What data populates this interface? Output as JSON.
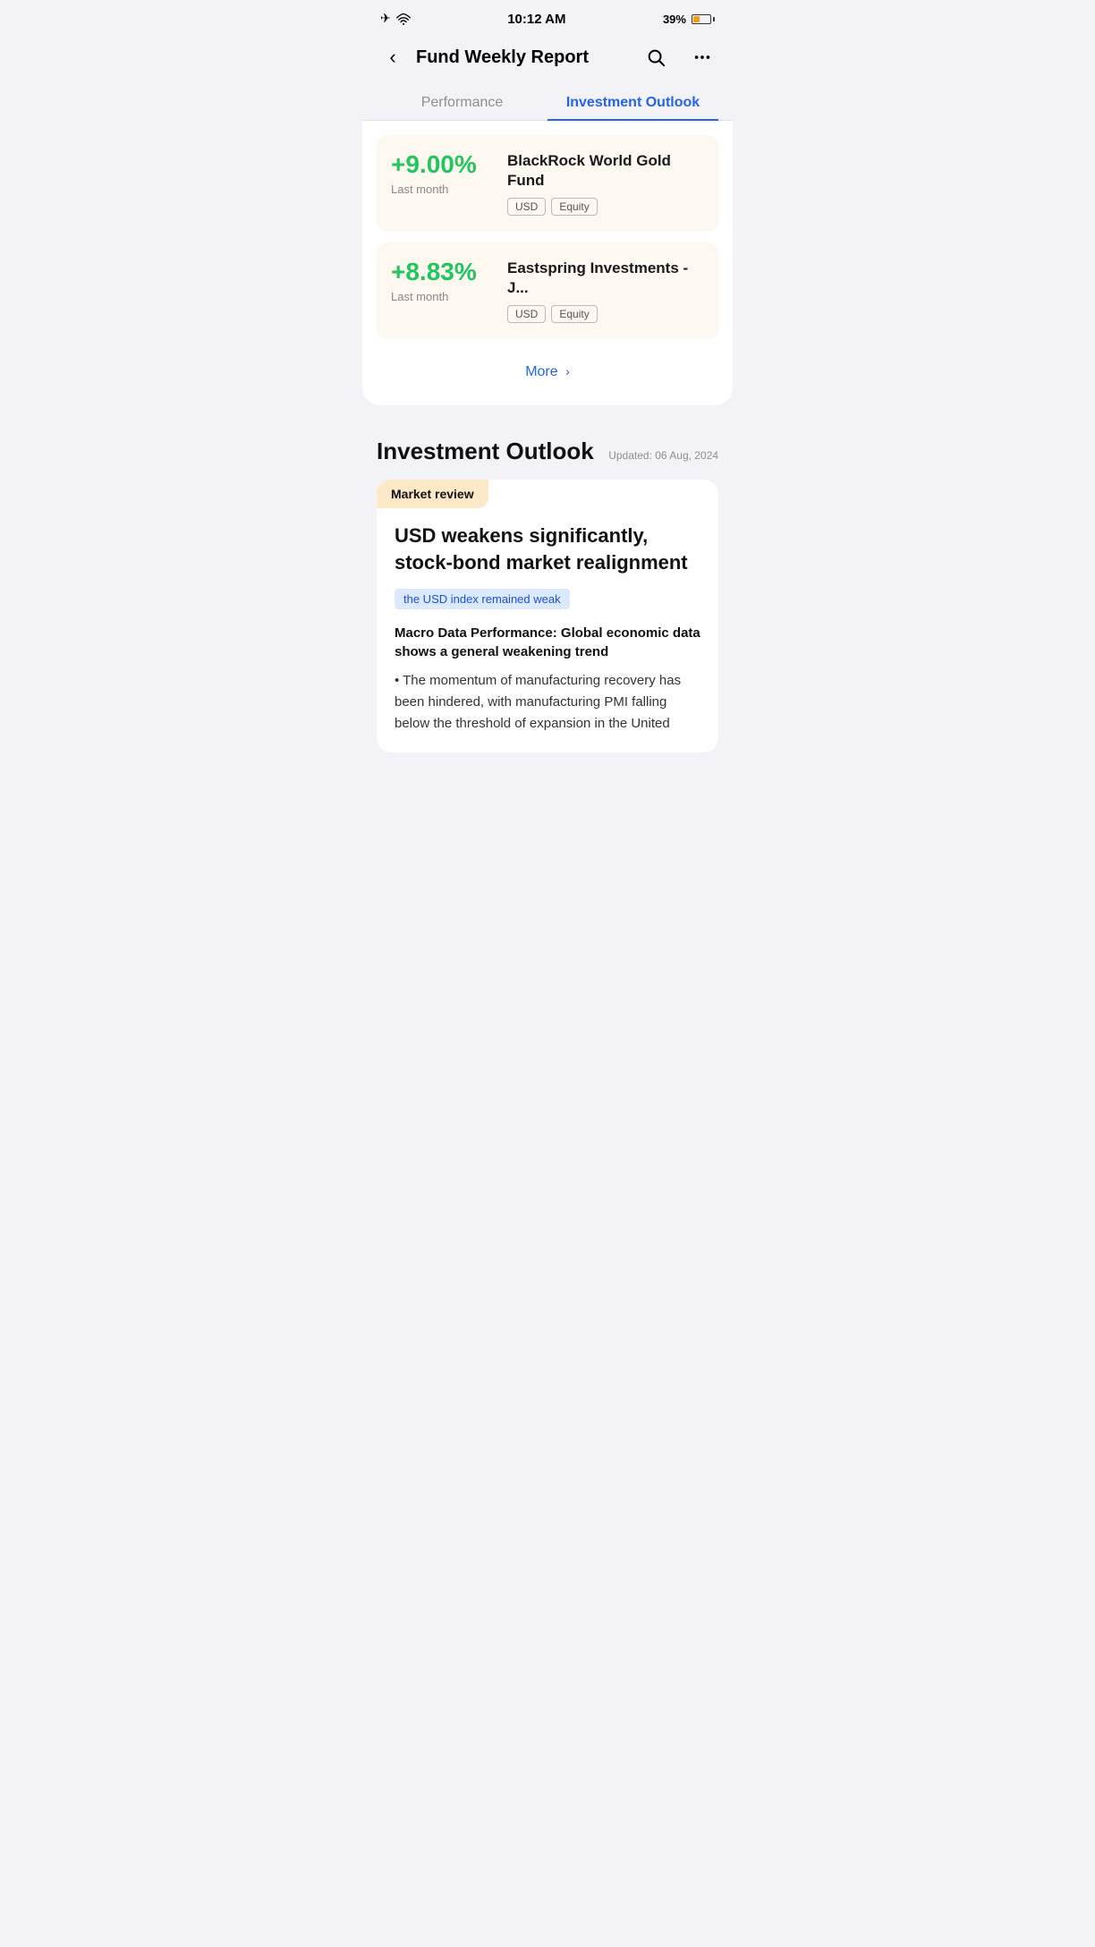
{
  "statusBar": {
    "time": "10:12 AM",
    "battery": "39%",
    "batteryFill": "40%"
  },
  "header": {
    "title": "Fund Weekly Report",
    "backLabel": "Back"
  },
  "tabs": [
    {
      "id": "performance",
      "label": "Performance",
      "active": false
    },
    {
      "id": "investment-outlook",
      "label": "Investment Outlook",
      "active": true
    }
  ],
  "performance": {
    "funds": [
      {
        "return": "+9.00%",
        "period": "Last month",
        "name": "BlackRock World Gold Fund",
        "tags": [
          "USD",
          "Equity"
        ]
      },
      {
        "return": "+8.83%",
        "period": "Last month",
        "name": "Eastspring Investments - J...",
        "tags": [
          "USD",
          "Equity"
        ]
      }
    ],
    "moreLabel": "More",
    "moreArrow": "›"
  },
  "investmentOutlook": {
    "sectionTitle": "Investment Outlook",
    "updatedLabel": "Updated: 06 Aug, 2024",
    "article": {
      "category": "Market review",
      "headline": "USD weakens significantly, stock-bond market realignment",
      "highlight": "the USD index remained weak",
      "subheading": "Macro Data Performance: Global economic data shows a general weakening trend",
      "bodyText": "• The momentum of manufacturing recovery has been hindered, with manufacturing PMI falling below the threshold of expansion in the United"
    }
  },
  "icons": {
    "search": "search-icon",
    "more": "more-icon",
    "back": "back-icon"
  }
}
